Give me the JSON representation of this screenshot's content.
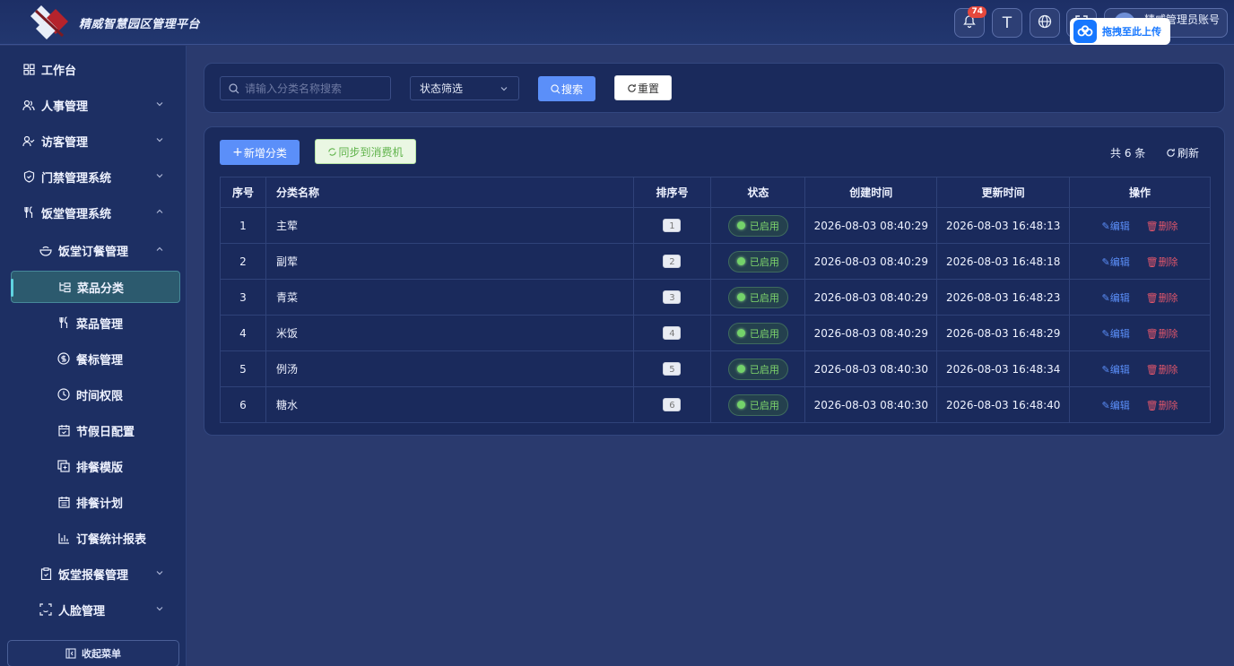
{
  "header": {
    "title": "精威智慧园区管理平台",
    "notification_count": "74",
    "font_icon": "T",
    "user_name": "精威管理员账号",
    "upload_label": "拖拽至此上传"
  },
  "sidebar": {
    "workbench": "工作台",
    "hr": "人事管理",
    "visitor": "访客管理",
    "access": "门禁管理系统",
    "canteen": "饭堂管理系统",
    "canteen_order": "饭堂订餐管理",
    "dish_category": "菜品分类",
    "dish_manage": "菜品管理",
    "meal_standard": "餐标管理",
    "time_permission": "时间权限",
    "holiday_config": "节假日配置",
    "meal_template": "排餐模版",
    "meal_plan": "排餐计划",
    "order_report": "订餐统计报表",
    "canteen_report": "饭堂报餐管理",
    "face": "人脸管理",
    "collapse": "收起菜单"
  },
  "filters": {
    "search_placeholder": "请输入分类名称搜索",
    "status_select": "状态筛选",
    "search_button": "搜索",
    "reset_button": "重置"
  },
  "toolbar": {
    "add_button": "新增分类",
    "sync_button": "同步到消费机",
    "total": "共 6 条",
    "refresh": "刷新"
  },
  "table": {
    "headers": {
      "index": "序号",
      "name": "分类名称",
      "sort": "排序号",
      "status": "状态",
      "created": "创建时间",
      "updated": "更新时间",
      "actions": "操作"
    },
    "edit_label": "编辑",
    "delete_label": "删除",
    "rows": [
      {
        "index": "1",
        "name": "主荤",
        "sort": "1",
        "status": "已启用",
        "created": "2026-08-03 08:40:29",
        "updated": "2026-08-03 16:48:13"
      },
      {
        "index": "2",
        "name": "副荤",
        "sort": "2",
        "status": "已启用",
        "created": "2026-08-03 08:40:29",
        "updated": "2026-08-03 16:48:18"
      },
      {
        "index": "3",
        "name": "青菜",
        "sort": "3",
        "status": "已启用",
        "created": "2026-08-03 08:40:29",
        "updated": "2026-08-03 16:48:23"
      },
      {
        "index": "4",
        "name": "米饭",
        "sort": "4",
        "status": "已启用",
        "created": "2026-08-03 08:40:29",
        "updated": "2026-08-03 16:48:29"
      },
      {
        "index": "5",
        "name": "例汤",
        "sort": "5",
        "status": "已启用",
        "created": "2026-08-03 08:40:30",
        "updated": "2026-08-03 16:48:34"
      },
      {
        "index": "6",
        "name": "糖水",
        "sort": "6",
        "status": "已启用",
        "created": "2026-08-03 08:40:30",
        "updated": "2026-08-03 16:48:40"
      }
    ]
  }
}
